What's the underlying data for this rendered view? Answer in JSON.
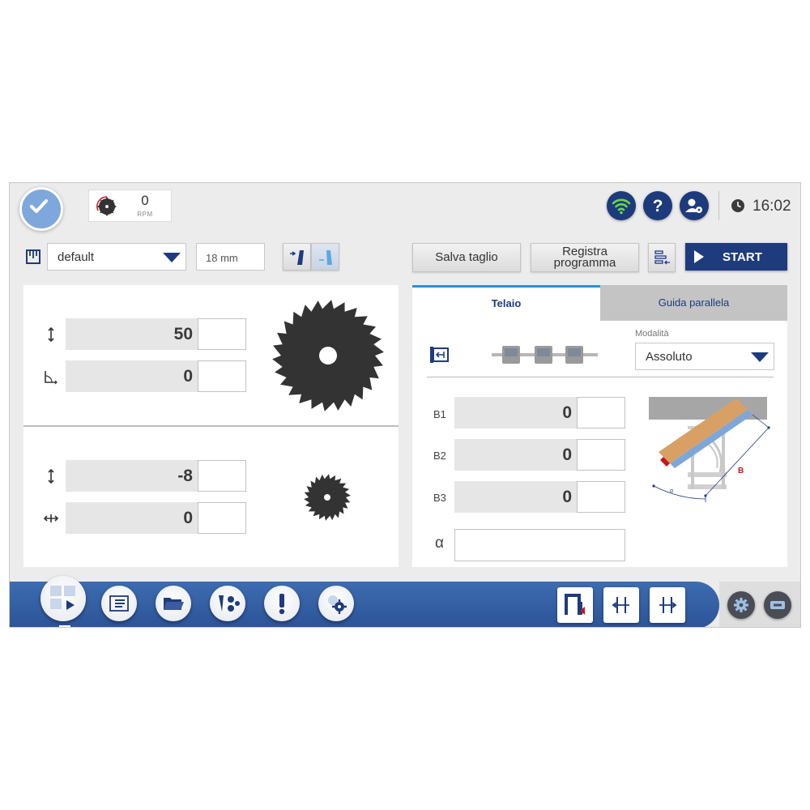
{
  "header": {
    "rpm_value": "0",
    "rpm_unit": "RPM",
    "time": "16:02"
  },
  "toolbar": {
    "profile_value": "default",
    "thickness_value": "18 mm",
    "save_cut_label": "Salva taglio",
    "register_program_line1": "Registra",
    "register_program_line2": "programma",
    "start_label": "START"
  },
  "main_blade": {
    "height_value": "50",
    "angle_value": "0"
  },
  "scoring_blade": {
    "height_value": "-8",
    "horizontal_value": "0"
  },
  "right_panel": {
    "tabs": [
      {
        "label": "Telaio",
        "active": true
      },
      {
        "label": "Guida parallela",
        "active": false
      }
    ],
    "mode_label": "Modalità",
    "mode_value": "Assoluto",
    "rows": [
      {
        "label": "B1",
        "value": "0"
      },
      {
        "label": "B2",
        "value": "0"
      },
      {
        "label": "B3",
        "value": "0"
      }
    ],
    "alpha_label": "α",
    "diagram_label": "B"
  },
  "taskbar": {
    "icons": [
      "program-run-icon",
      "list-icon",
      "folder-icon",
      "tools-icon",
      "alert-icon",
      "settings-icon"
    ],
    "right_buttons": [
      "frame-icon",
      "fence-left-icon",
      "fence-right-icon"
    ],
    "system_icons": [
      "gear-icon",
      "keyboard-icon"
    ]
  },
  "colors": {
    "brand": "#1e3b7e",
    "accent": "#2e8fd6",
    "check": "#7ea8dc",
    "wifi": "#6bd54a",
    "warning": "#c4161c"
  }
}
